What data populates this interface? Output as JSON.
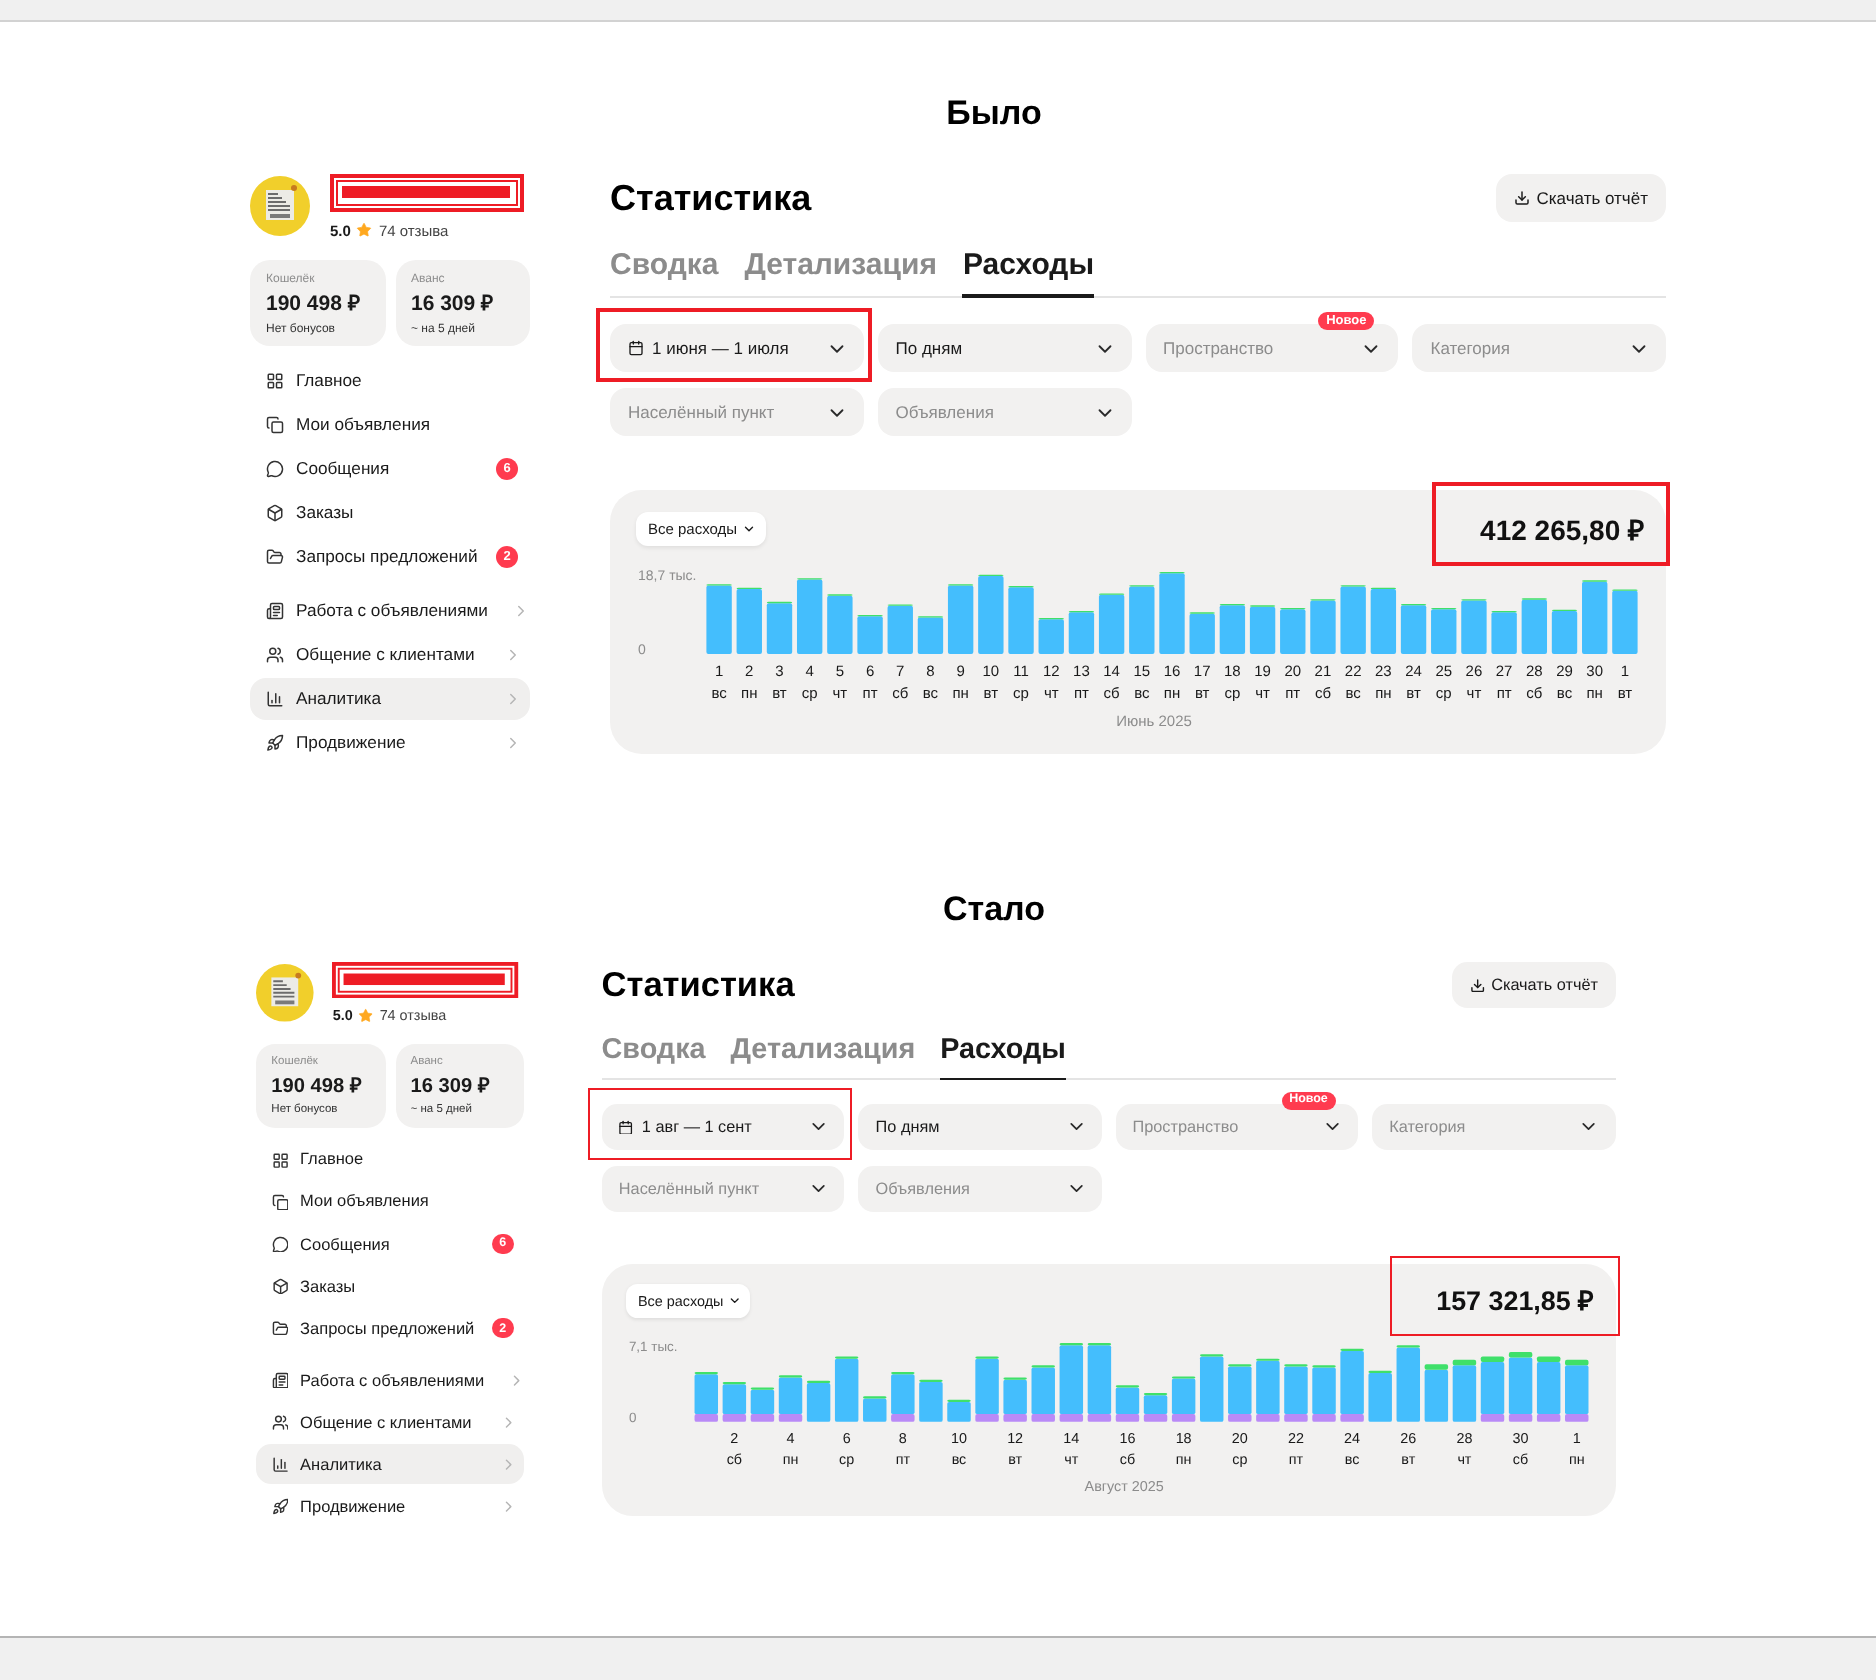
{
  "sections": [
    {
      "heading": "Было",
      "screen": {
        "profile": {
          "rating": "5.0",
          "reviews": "74 отзыва"
        },
        "balances": [
          {
            "label": "Кошелёк",
            "amount": "190 498 ₽",
            "note": "Нет бонусов"
          },
          {
            "label": "Аванс",
            "amount": "16 309 ₽",
            "note": "~ на 5 дней"
          }
        ],
        "nav_groups": [
          {
            "items": [
              {
                "label": "Главное",
                "selected": false
              },
              {
                "label": "Мои объявления",
                "selected": false
              },
              {
                "label": "Сообщения",
                "selected": false,
                "badge": "6"
              },
              {
                "label": "Заказы",
                "selected": false
              },
              {
                "label": "Запросы предложений",
                "selected": false,
                "badge": "2"
              }
            ]
          },
          {
            "items": [
              {
                "label": "Работа с объявлениями",
                "selected": false,
                "expanded": false
              },
              {
                "label": "Общение с клиентами",
                "selected": false,
                "expanded": false
              },
              {
                "label": "Аналитика",
                "selected": true,
                "expanded": false
              },
              {
                "label": "Продвижение",
                "selected": false,
                "expanded": false
              }
            ]
          }
        ],
        "title": "Статистика",
        "download_button": "Скачать отчёт",
        "tabs": [
          {
            "label": "Сводка",
            "selected": false
          },
          {
            "label": "Детализация",
            "selected": false
          },
          {
            "label": "Расходы",
            "selected": true
          }
        ],
        "filters": [
          {
            "kind": "date",
            "value": "1 июня — 1 июля",
            "highlighted": true
          },
          {
            "kind": "select",
            "value": "По дням",
            "highlighted": false
          },
          {
            "kind": "select",
            "placeholder": "Пространство",
            "badge": "Новое",
            "highlighted": false
          },
          {
            "kind": "select",
            "placeholder": "Категория",
            "highlighted": false
          },
          {
            "kind": "select",
            "placeholder": "Населённый пункт",
            "highlighted": false
          },
          {
            "kind": "select",
            "placeholder": "Объявления",
            "highlighted": false
          }
        ],
        "expenses": {
          "selector": "Все расходы",
          "total": "412 265,80 ₽",
          "total_highlighted": true,
          "chart_data": {
            "type": "bar",
            "stacked": true,
            "xlabel": "Июнь 2025",
            "categories": [
              "1\nвс",
              "2\nпн",
              "3\nвт",
              "4\nср",
              "5\nчт",
              "6\nпт",
              "7\nсб",
              "8\nвс",
              "9\nпн",
              "10\nвт",
              "11\nср",
              "12\nчт",
              "13\nпт",
              "14\nсб",
              "15\nвс",
              "16\nпн",
              "17\nвт",
              "18\nср",
              "19\nчт",
              "20\nпт",
              "21\nсб",
              "22\nвс",
              "23\nпн",
              "24\nвт",
              "25\nср",
              "26\nчт",
              "27\nпт",
              "28\nсб",
              "29\nвс",
              "30\nпн",
              "1\nвт"
            ],
            "ylim": [
              0,
              18.7
            ],
            "yticks": [
              {
                "value": 0,
                "label": "0"
              },
              {
                "value": 18.7,
                "label": "18,7 тыс."
              }
            ],
            "series": [
              {
                "color": "#44befd",
                "values": [
                  15.6,
                  14.8,
                  11.6,
                  17.0,
                  13.3,
                  8.6,
                  11.0,
                  8.3,
                  15.6,
                  17.8,
                  15.2,
                  7.9,
                  9.5,
                  13.5,
                  15.4,
                  18.4,
                  9.2,
                  11.1,
                  10.8,
                  10.2,
                  12.2,
                  15.4,
                  14.8,
                  11.1,
                  10.2,
                  12.2,
                  9.5,
                  12.4,
                  9.8,
                  16.5,
                  14.4
                ]
              },
              {
                "color": "#3fe06a",
                "values": [
                  0.3,
                  0.3,
                  0.3,
                  0.3,
                  0.3,
                  0.3,
                  0.3,
                  0.3,
                  0.3,
                  0.3,
                  0.3,
                  0.3,
                  0.3,
                  0.3,
                  0.3,
                  0.3,
                  0.3,
                  0.3,
                  0.3,
                  0.3,
                  0.3,
                  0.3,
                  0.3,
                  0.3,
                  0.3,
                  0.3,
                  0.3,
                  0.3,
                  0.3,
                  0.3,
                  0.3
                ]
              }
            ]
          }
        }
      }
    },
    {
      "heading": "Стало",
      "screen": {
        "profile": {
          "rating": "5.0",
          "reviews": "74 отзыва"
        },
        "balances": [
          {
            "label": "Кошелёк",
            "amount": "190 498 ₽",
            "note": "Нет бонусов"
          },
          {
            "label": "Аванс",
            "amount": "16 309 ₽",
            "note": "~ на 5 дней"
          }
        ],
        "nav_groups": [
          {
            "items": [
              {
                "label": "Главное",
                "selected": false
              },
              {
                "label": "Мои объявления",
                "selected": false
              },
              {
                "label": "Сообщения",
                "selected": false,
                "badge": "6"
              },
              {
                "label": "Заказы",
                "selected": false
              },
              {
                "label": "Запросы предложений",
                "selected": false,
                "badge": "2"
              }
            ]
          },
          {
            "items": [
              {
                "label": "Работа с объявлениями",
                "selected": false,
                "expanded": false
              },
              {
                "label": "Общение с клиентами",
                "selected": false,
                "expanded": false
              },
              {
                "label": "Аналитика",
                "selected": true,
                "expanded": false
              },
              {
                "label": "Продвижение",
                "selected": false,
                "expanded": false
              }
            ]
          }
        ],
        "title": "Статистика",
        "download_button": "Скачать отчёт",
        "tabs": [
          {
            "label": "Сводка",
            "selected": false
          },
          {
            "label": "Детализация",
            "selected": false
          },
          {
            "label": "Расходы",
            "selected": true
          }
        ],
        "filters": [
          {
            "kind": "date",
            "value": "1 авг — 1 сент",
            "highlighted": true
          },
          {
            "kind": "select",
            "value": "По дням",
            "highlighted": false
          },
          {
            "kind": "select",
            "placeholder": "Пространство",
            "badge": "Новое",
            "highlighted": false
          },
          {
            "kind": "select",
            "placeholder": "Категория",
            "highlighted": false
          },
          {
            "kind": "select",
            "placeholder": "Населённый пункт",
            "highlighted": false
          },
          {
            "kind": "select",
            "placeholder": "Объявления",
            "highlighted": false
          }
        ],
        "expenses": {
          "selector": "Все расходы",
          "total": "157 321,85 ₽",
          "total_highlighted": true,
          "chart_data": {
            "type": "bar",
            "stacked": true,
            "xlabel": "Август 2025",
            "categories": [
              null,
              "2\nсб",
              null,
              "4\nпн",
              null,
              "6\nср",
              null,
              "8\nпт",
              null,
              "10\nвс",
              null,
              "12\nвт",
              null,
              "14\nчт",
              null,
              "16\nсб",
              null,
              "18\nпн",
              null,
              "20\nср",
              null,
              "22\nпт",
              null,
              "24\nвс",
              null,
              "26\nвт",
              null,
              "28\nчт",
              null,
              "30\nсб",
              null,
              "1\nпн"
            ],
            "ylim": [
              0,
              7.1
            ],
            "yticks": [
              {
                "value": 0,
                "label": "0"
              },
              {
                "value": 7.1,
                "label": "7,1 тыс."
              }
            ],
            "series": [
              {
                "color": "#b98af7",
                "values": [
                  0.7,
                  0.7,
                  0.7,
                  0.7,
                  0,
                  0,
                  0,
                  0.7,
                  0,
                  0,
                  0.7,
                  0.7,
                  0.7,
                  0.7,
                  0.7,
                  0.7,
                  0.7,
                  0.7,
                  0,
                  0.7,
                  0.7,
                  0.7,
                  0.7,
                  0.7,
                  0,
                  0,
                  0,
                  0,
                  0.7,
                  0.7,
                  0.7,
                  0.7
                ]
              },
              {
                "color": "#44befd",
                "values": [
                  3.6,
                  2.7,
                  2.2,
                  3.3,
                  3.5,
                  5.7,
                  2.1,
                  3.6,
                  3.6,
                  1.8,
                  5.0,
                  3.1,
                  4.2,
                  6.2,
                  6.2,
                  2.4,
                  1.7,
                  3.2,
                  5.9,
                  4.3,
                  4.8,
                  4.3,
                  4.2,
                  5.7,
                  4.4,
                  6.7,
                  4.7,
                  5.1,
                  4.7,
                  5.1,
                  4.7,
                  4.4
                ]
              },
              {
                "color": "#3fe06a",
                "values": [
                  0.2,
                  0.2,
                  0.2,
                  0.2,
                  0.2,
                  0.2,
                  0.2,
                  0.2,
                  0.2,
                  0.2,
                  0.2,
                  0.2,
                  0.2,
                  0.2,
                  0.2,
                  0.2,
                  0.2,
                  0.2,
                  0.2,
                  0.2,
                  0.2,
                  0.2,
                  0.2,
                  0.2,
                  0.2,
                  0.2,
                  0.5,
                  0.5,
                  0.5,
                  0.5,
                  0.5,
                  0.5
                ]
              }
            ]
          }
        }
      }
    }
  ]
}
